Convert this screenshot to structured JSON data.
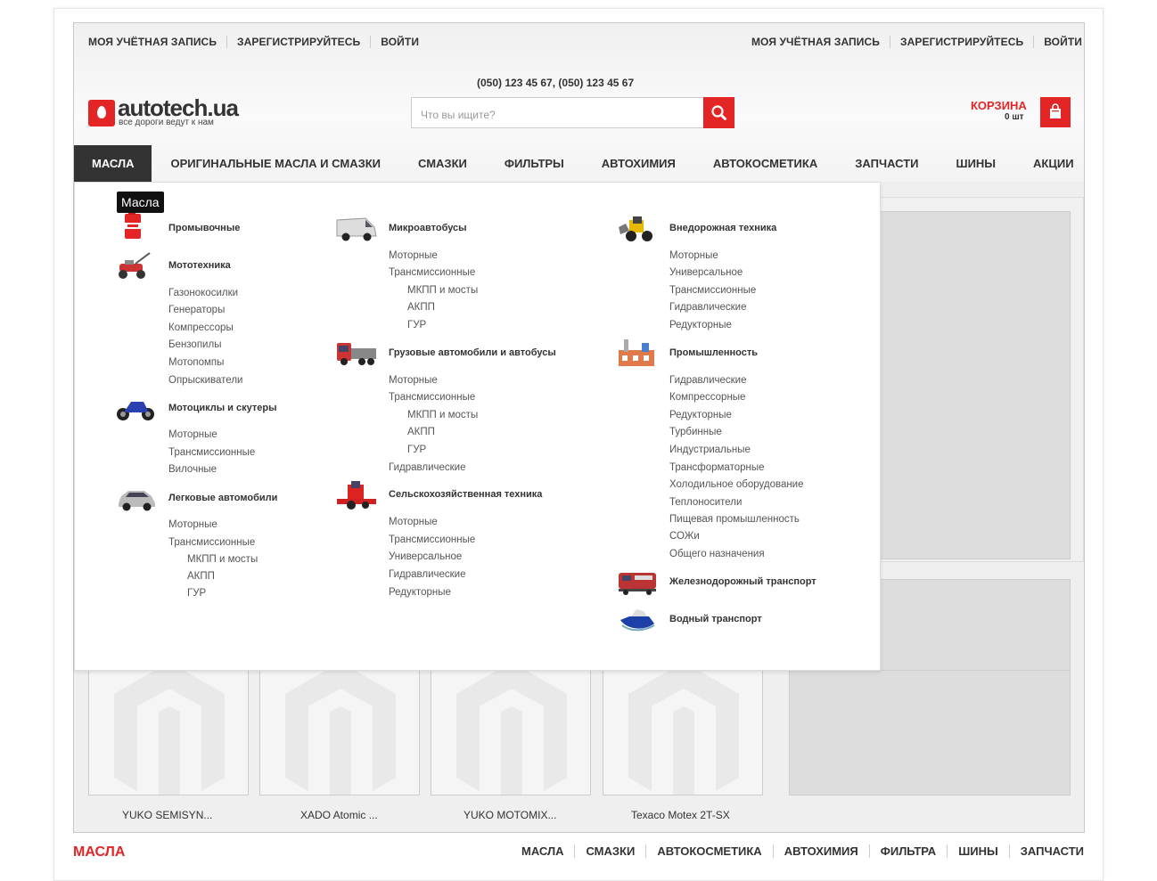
{
  "header": {
    "left_links": [
      "МОЯ УЧЁТНАЯ ЗАПИСЬ",
      "ЗАРЕГИСТРИРУЙТЕСЬ",
      "ВОЙТИ"
    ],
    "right_links": [
      "МОЯ УЧЁТНАЯ ЗАПИСЬ",
      "ЗАРЕГИСТРИРУЙТЕСЬ",
      "ВОЙТИ"
    ],
    "phone": "(050) 123 45 67, (050) 123 45 67",
    "logo_name": "autotech",
    "logo_tld": ".ua",
    "logo_slogan": "все дороги ведут к нам",
    "search_placeholder": "Что вы ищите?",
    "cart_label": "КОРЗИНА",
    "cart_count": "0 шт",
    "accent_color": "#e32526"
  },
  "nav": {
    "items": [
      "МАСЛА",
      "ОРИГИНАЛЬНЫЕ МАСЛА И СМАЗКИ",
      "СМАЗКИ",
      "ФИЛЬТРЫ",
      "АВТОХИМИЯ",
      "АВТОКОСМЕТИКА",
      "ЗАПЧАСТИ",
      "ШИНЫ",
      "АКЦИИ"
    ],
    "active": "МАСЛА"
  },
  "tooltip": "Масла",
  "menu": {
    "col1": [
      {
        "title": "Промывочные",
        "icon": "oil-can-icon",
        "items": []
      },
      {
        "title": "Мототехника",
        "icon": "mower-icon",
        "items": [
          "Газонокосилки",
          "Генераторы",
          "Компрессоры",
          "Бензопилы",
          "Мотопомпы",
          "Опрыскиватели"
        ]
      },
      {
        "title": "Мотоциклы и скутеры",
        "icon": "motorcycle-icon",
        "items": [
          "Моторные",
          "Трансмиссионные",
          "Вилочные"
        ]
      },
      {
        "title": "Легковые автомобили",
        "icon": "car-icon",
        "items": [
          "Моторные",
          "Трансмиссионные"
        ],
        "subitems": [
          "МКПП и мосты",
          "АКПП",
          "ГУР"
        ]
      }
    ],
    "col2": [
      {
        "title": "Микроавтобусы",
        "icon": "van-icon",
        "items": [
          "Моторные",
          "Трансмиссионные"
        ],
        "subitems": [
          "МКПП и мосты",
          "АКПП",
          "ГУР"
        ]
      },
      {
        "title": "Грузовые автомобили и автобусы",
        "icon": "truck-icon",
        "items": [
          "Моторные",
          "Трансмиссионные"
        ],
        "subitems": [
          "МКПП и мосты",
          "АКПП",
          "ГУР"
        ],
        "after": [
          "Гидравлические"
        ]
      },
      {
        "title": "Сельскохозяйственная техника",
        "icon": "harvester-icon",
        "items": [
          "Моторные",
          "Трансмиссионные",
          "Универсальное",
          "Гидравлические",
          "Редукторные"
        ]
      }
    ],
    "col3": [
      {
        "title": "Внедорожная техника",
        "icon": "loader-icon",
        "items": [
          "Моторные",
          "Универсальное",
          "Трансмиссионные",
          "Гидравлические",
          "Редукторные"
        ]
      },
      {
        "title": "Промышленность",
        "icon": "factory-icon",
        "items": [
          "Гидравлические",
          "Компрессорные",
          "Редукторные",
          "Турбинные",
          "Индустриальные",
          "Трансформаторные",
          "Холодильное оборудование",
          "Теплоносители",
          "Пищевая промышленность",
          "СОЖи",
          "Общего назначения"
        ]
      },
      {
        "title": "Железнодорожный транспорт",
        "icon": "train-icon",
        "items": []
      },
      {
        "title": "Водный транспорт",
        "icon": "boat-icon",
        "items": []
      }
    ]
  },
  "products": [
    "YUKO SEMISYN...",
    "XADO Atomic ...",
    "YUKO MOTOMIX...",
    "Texaco Motex 2T-SX"
  ],
  "footer": {
    "title": "МАСЛА",
    "links": [
      "МАСЛА",
      "СМАЗКИ",
      "АВТОКОСМЕТИКА",
      "АВТОХИМИЯ",
      "ФИЛЬТРА",
      "ШИНЫ",
      "ЗАПЧАСТИ"
    ]
  }
}
